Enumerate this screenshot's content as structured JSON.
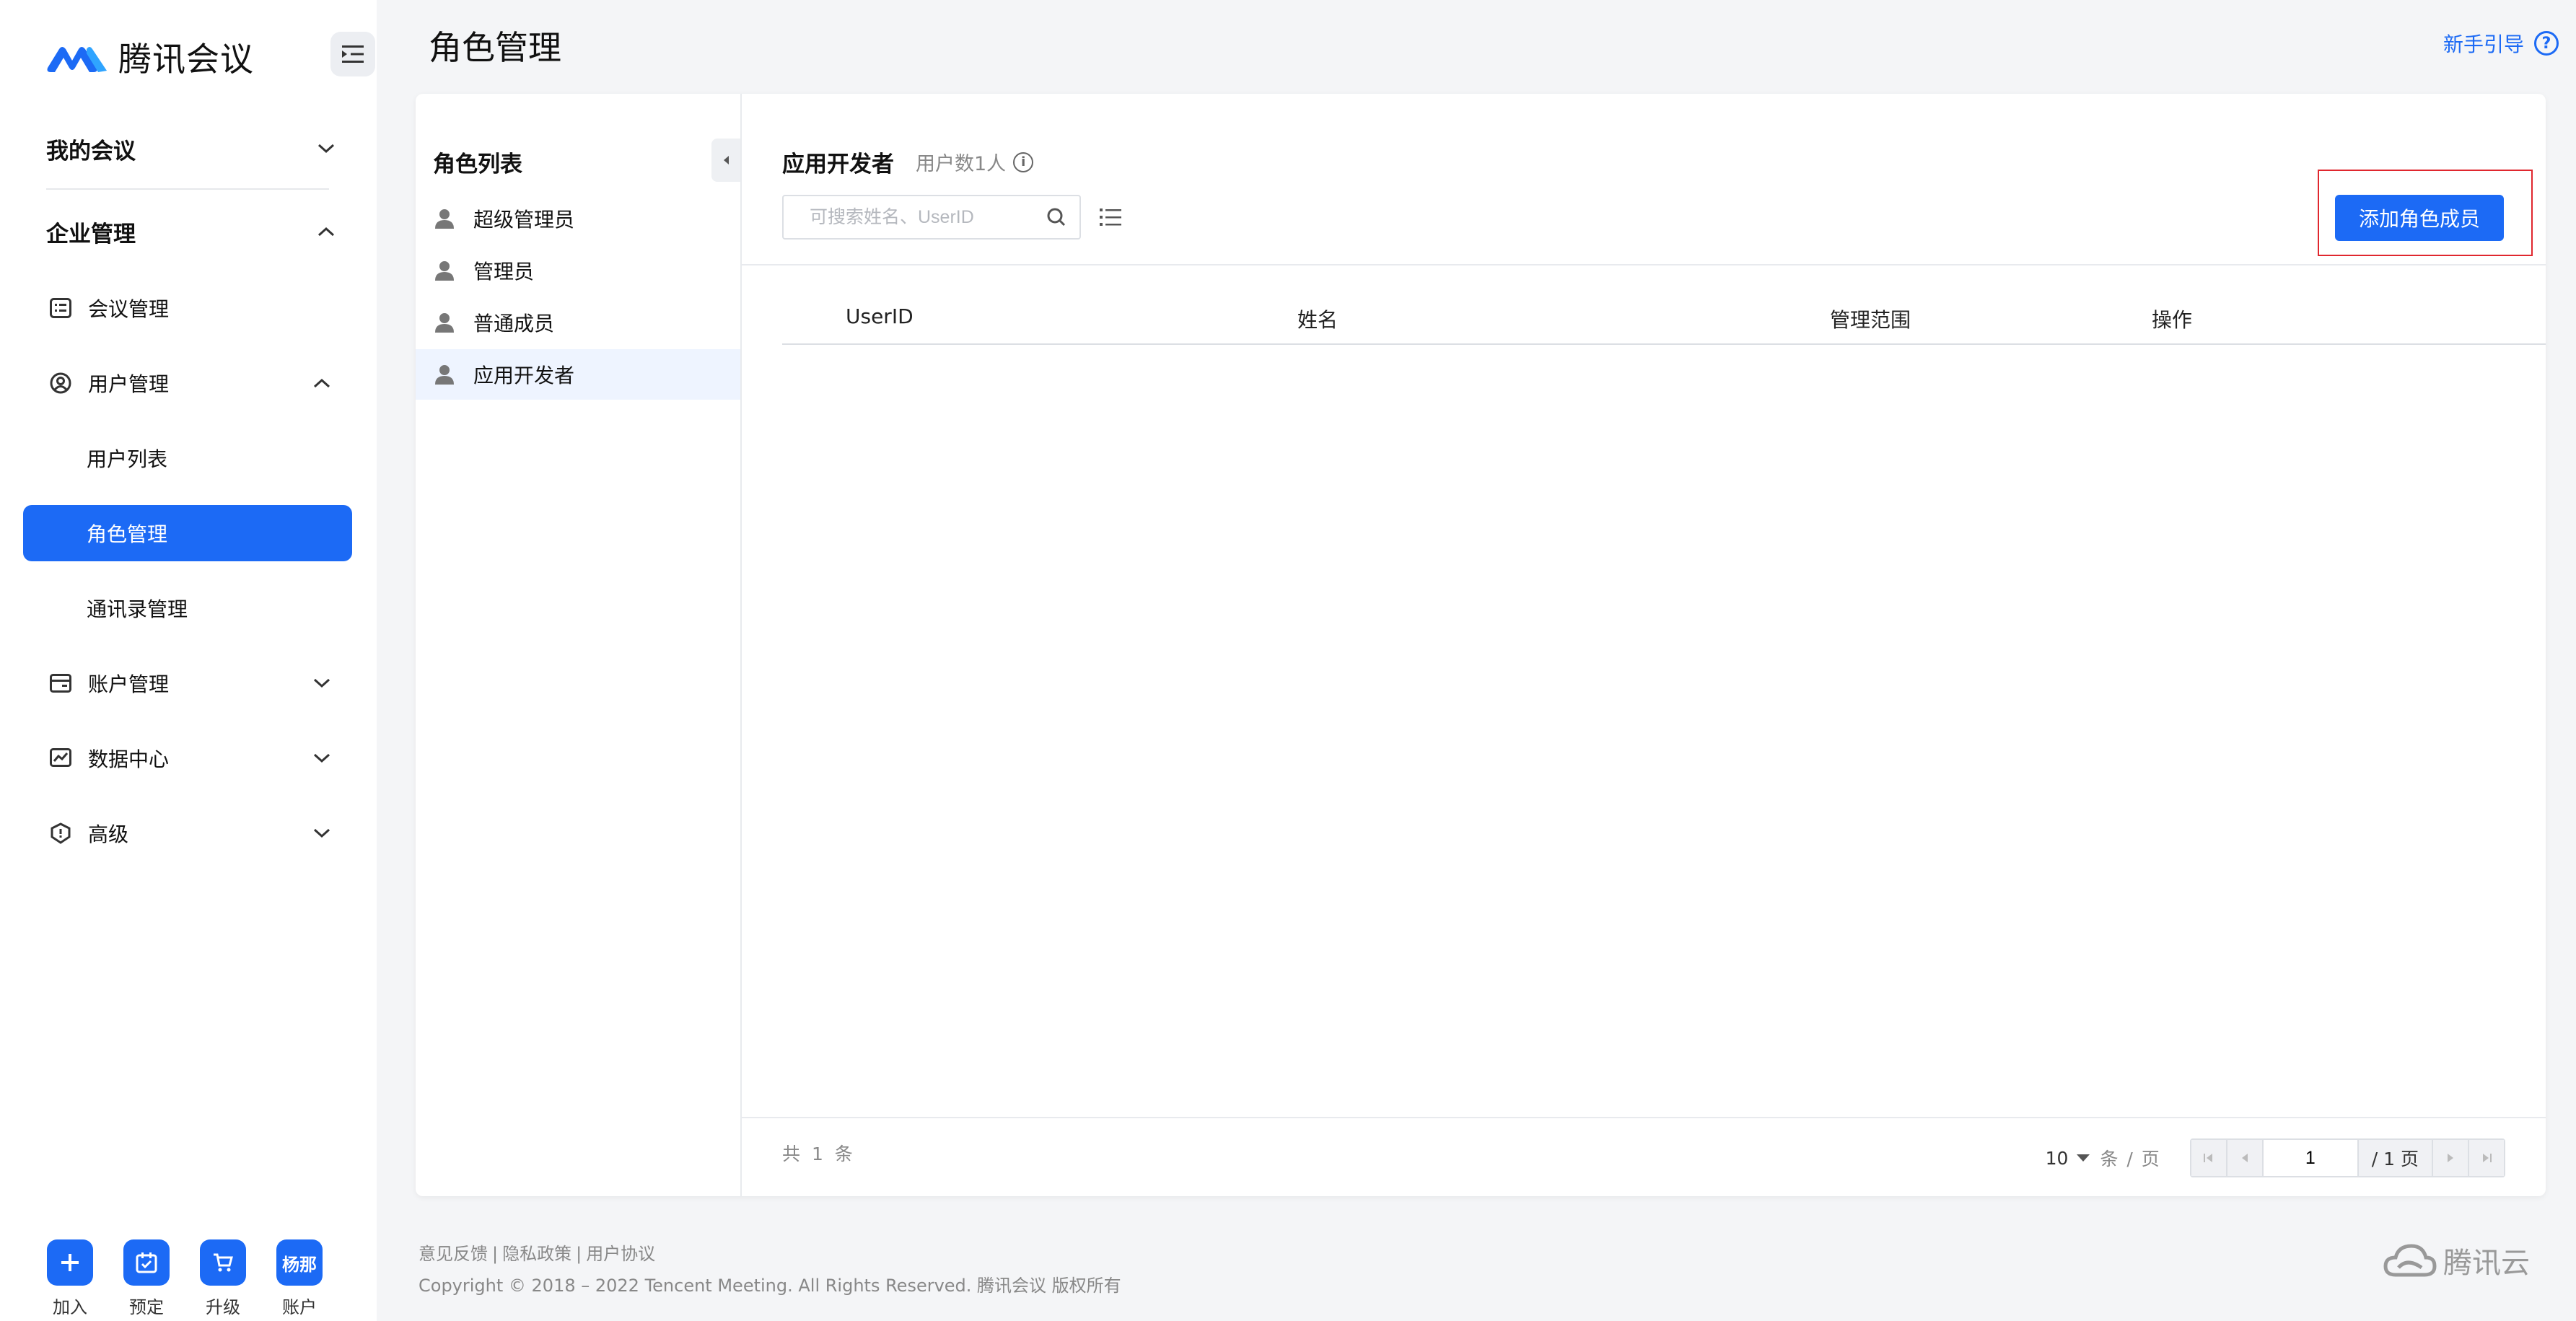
{
  "app": {
    "name": "腾讯会议"
  },
  "sidebar": {
    "sections": [
      {
        "label": "我的会议",
        "expanded": false
      },
      {
        "label": "企业管理",
        "expanded": true
      }
    ],
    "items": [
      {
        "label": "会议管理",
        "icon": "list-icon"
      },
      {
        "label": "用户管理",
        "icon": "user-circle-icon",
        "expanded": true
      },
      {
        "label": "用户列表"
      },
      {
        "label": "角色管理",
        "active": true
      },
      {
        "label": "通讯录管理"
      },
      {
        "label": "账户管理",
        "icon": "wallet-icon"
      },
      {
        "label": "数据中心",
        "icon": "chart-icon"
      },
      {
        "label": "高级",
        "icon": "shield-icon"
      }
    ],
    "bottom": [
      {
        "label": "加入",
        "icon": "plus-icon"
      },
      {
        "label": "预定",
        "icon": "calendar-check-icon"
      },
      {
        "label": "升级",
        "icon": "cart-icon"
      },
      {
        "label": "账户",
        "avatar_text": "杨那"
      }
    ]
  },
  "header": {
    "title": "角色管理",
    "guide_label": "新手引导",
    "guide_icon": "?"
  },
  "roles": {
    "title": "角色列表",
    "items": [
      {
        "label": "超级管理员"
      },
      {
        "label": "管理员"
      },
      {
        "label": "普通成员"
      },
      {
        "label": "应用开发者",
        "active": true
      }
    ]
  },
  "detail": {
    "title": "应用开发者",
    "user_count": "用户数1人",
    "info_icon": "i",
    "search_placeholder": "可搜索姓名、UserID",
    "add_button": "添加角色成员",
    "columns": [
      "UserID",
      "姓名",
      "管理范围",
      "操作"
    ],
    "total_text": "共 1 条",
    "pagination": {
      "page_size": "10",
      "page_size_unit": "条 / 页",
      "current_page": "1",
      "total_pages": "/ 1 页"
    }
  },
  "footer": {
    "links": [
      "意见反馈",
      "隐私政策",
      "用户协议"
    ],
    "copyright": "Copyright © 2018 – 2022 Tencent Meeting. All Rights Reserved. 腾讯会议 版权所有",
    "brand": "腾讯云"
  },
  "colors": {
    "accent": "#1c6af5",
    "highlight_outline": "#e0272e",
    "background": "#f4f5f7"
  }
}
